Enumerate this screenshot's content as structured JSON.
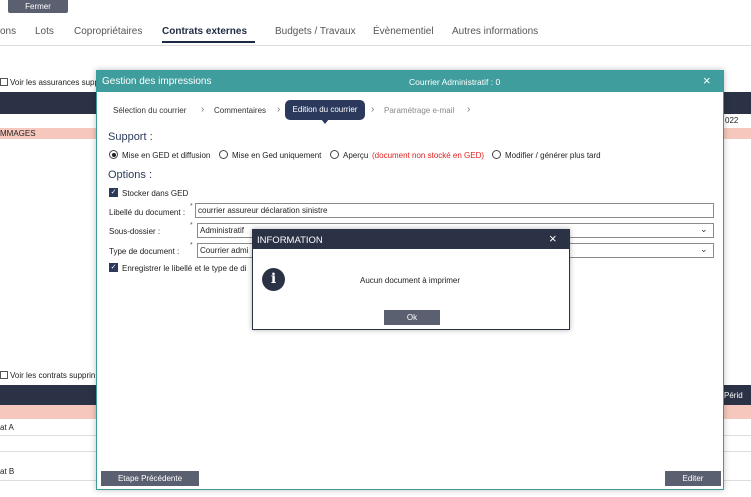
{
  "background": {
    "close_label": "Fermer",
    "tabs": [
      "ons",
      "Lots",
      "Copropriétaires",
      "Contrats externes",
      "Budgets / Travaux",
      "Évènementiel",
      "Autres informations"
    ],
    "active_tab": "Contrats externes",
    "assurances_checkbox": "Voir les assurances supp",
    "pink_row_text": "MMAGES",
    "right_year": "022",
    "contrats_checkbox": "Voir les contrats supprin",
    "right_header": "Périd",
    "rows": [
      "at A",
      "at B"
    ]
  },
  "dialog": {
    "title": "Gestion des impressions",
    "center_title": "Courrier Administratif : 0",
    "close_icon": "×",
    "steps": [
      "Sélection du courrier",
      "Commentaires",
      "Edition du courrier",
      "Paramétrage e-mail"
    ],
    "active_step": "Edition du courrier",
    "support_title": "Support :",
    "support_options": [
      {
        "label": "Mise en GED et diffusion",
        "selected": true
      },
      {
        "label": "Mise en Ged uniquement",
        "selected": false
      },
      {
        "label": "Aperçu",
        "note": "(document non stocké en GED)",
        "selected": false
      },
      {
        "label": "Modifier / générer plus tard",
        "selected": false
      }
    ],
    "options_title": "Options :",
    "store_ged": "Stocker dans GED",
    "doc_label": "Libellé du document :",
    "doc_value": "courrier assureur déclaration sinistre",
    "subfolder_label": "Sous-dossier :",
    "subfolder_value": "Administratif",
    "doctype_label": "Type de document :",
    "doctype_value": "Courrier admi",
    "save_label": "Enregistrer le libellé et le type de di",
    "required_mark": "*",
    "prev_button": "Etape Précédente",
    "edit_button": "Editer",
    "accent_color": "#3f9d9d",
    "dark_color": "#2b3a5c"
  },
  "info": {
    "title": "INFORMATION",
    "close_icon": "×",
    "icon": "info-icon",
    "message": "Aucun document à imprimer",
    "ok_label": "Ok"
  }
}
